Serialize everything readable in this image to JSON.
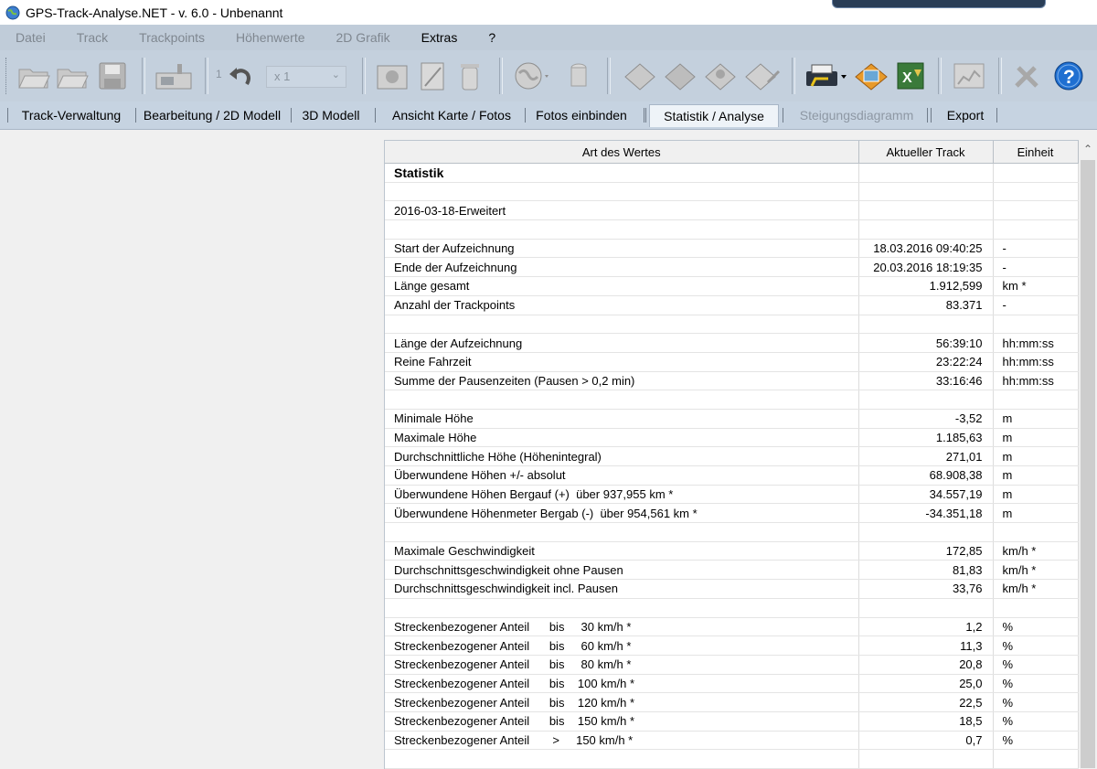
{
  "window": {
    "title": "GPS-Track-Analyse.NET  -  v. 6.0  -  Unbenannt"
  },
  "menu": [
    {
      "label": "Datei",
      "active": false
    },
    {
      "label": "Track",
      "active": false
    },
    {
      "label": "Trackpoints",
      "active": false
    },
    {
      "label": "Höhenwerte",
      "active": false
    },
    {
      "label": "2D Grafik",
      "active": false
    },
    {
      "label": "Extras",
      "active": true
    },
    {
      "label": "?",
      "active": true
    }
  ],
  "toolbar": {
    "undo_count": "1",
    "zoom_value": "x 1"
  },
  "tabs": [
    {
      "label": "Track-Verwaltung",
      "state": "normal"
    },
    {
      "label": "Bearbeitung / 2D Modell",
      "state": "normal"
    },
    {
      "label": "3D Modell",
      "state": "normal"
    },
    {
      "label": "Ansicht Karte / Fotos",
      "state": "normal"
    },
    {
      "label": "Fotos einbinden",
      "state": "normal"
    },
    {
      "label": "Statistik / Analyse",
      "state": "selected"
    },
    {
      "label": "Steigungsdiagramm",
      "state": "disabled"
    },
    {
      "label": "Export",
      "state": "normal"
    }
  ],
  "table": {
    "headers": [
      "Art des Wertes",
      "Aktueller Track",
      "Einheit"
    ],
    "rows": [
      {
        "name": "Statistik",
        "value": "",
        "unit": "",
        "kind": "header"
      },
      {
        "name": "",
        "value": "",
        "unit": ""
      },
      {
        "name": "2016-03-18-Erweitert",
        "value": "",
        "unit": ""
      },
      {
        "name": "",
        "value": "",
        "unit": ""
      },
      {
        "name": "Start der Aufzeichnung",
        "value": "18.03.2016 09:40:25",
        "unit": "-"
      },
      {
        "name": "Ende der Aufzeichnung",
        "value": "20.03.2016 18:19:35",
        "unit": "-"
      },
      {
        "name": "Länge gesamt",
        "value": "1.912,599",
        "unit": "km *"
      },
      {
        "name": "Anzahl der Trackpoints",
        "value": "83.371",
        "unit": "-"
      },
      {
        "name": "",
        "value": "",
        "unit": ""
      },
      {
        "name": "Länge der Aufzeichnung",
        "value": "56:39:10",
        "unit": "hh:mm:ss"
      },
      {
        "name": "Reine Fahrzeit",
        "value": "23:22:24",
        "unit": "hh:mm:ss"
      },
      {
        "name": "Summe der Pausenzeiten (Pausen > 0,2 min)",
        "value": "33:16:46",
        "unit": "hh:mm:ss"
      },
      {
        "name": "",
        "value": "",
        "unit": ""
      },
      {
        "name": "Minimale Höhe",
        "value": "-3,52",
        "unit": "m"
      },
      {
        "name": "Maximale Höhe",
        "value": "1.185,63",
        "unit": "m"
      },
      {
        "name": "Durchschnittliche Höhe (Höhenintegral)",
        "value": "271,01",
        "unit": "m"
      },
      {
        "name": "Überwundene Höhen +/- absolut",
        "value": "68.908,38",
        "unit": "m"
      },
      {
        "name": "Überwundene Höhen Bergauf (+)  über 937,955 km *",
        "value": "34.557,19",
        "unit": "m"
      },
      {
        "name": "Überwundene Höhenmeter Bergab (-)  über 954,561 km *",
        "value": "-34.351,18",
        "unit": "m"
      },
      {
        "name": "",
        "value": "",
        "unit": ""
      },
      {
        "name": "Maximale Geschwindigkeit",
        "value": "172,85",
        "unit": "km/h *"
      },
      {
        "name": "Durchschnittsgeschwindigkeit ohne Pausen",
        "value": "81,83",
        "unit": "km/h *"
      },
      {
        "name": "Durchschnittsgeschwindigkeit incl. Pausen",
        "value": "33,76",
        "unit": "km/h *"
      },
      {
        "name": "",
        "value": "",
        "unit": ""
      },
      {
        "name": "Streckenbezogener Anteil      bis     30 km/h *",
        "value": "1,2",
        "unit": "%"
      },
      {
        "name": "Streckenbezogener Anteil      bis     60 km/h *",
        "value": "11,3",
        "unit": "%"
      },
      {
        "name": "Streckenbezogener Anteil      bis     80 km/h *",
        "value": "20,8",
        "unit": "%"
      },
      {
        "name": "Streckenbezogener Anteil      bis    100 km/h *",
        "value": "25,0",
        "unit": "%"
      },
      {
        "name": "Streckenbezogener Anteil      bis    120 km/h *",
        "value": "22,5",
        "unit": "%"
      },
      {
        "name": "Streckenbezogener Anteil      bis    150 km/h *",
        "value": "18,5",
        "unit": "%"
      },
      {
        "name": "Streckenbezogener Anteil       >     150 km/h *",
        "value": "0,7",
        "unit": "%"
      },
      {
        "name": "",
        "value": "",
        "unit": ""
      }
    ]
  }
}
